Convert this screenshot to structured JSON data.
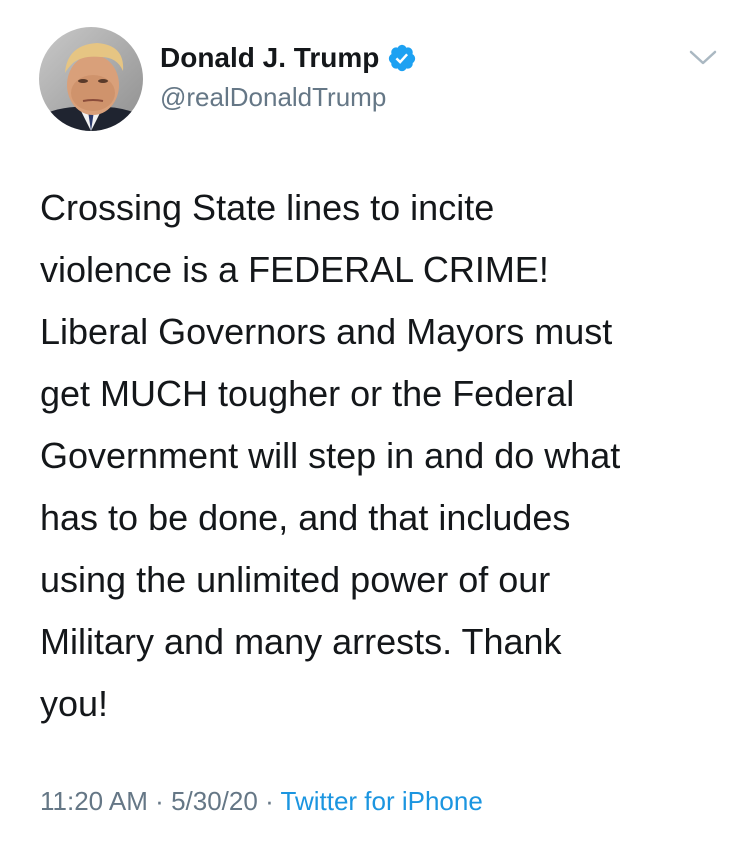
{
  "author": {
    "display_name": "Donald J. Trump",
    "handle": "@realDonaldTrump",
    "verified": true,
    "verified_icon": "verified-badge-icon",
    "avatar": "profile-photo"
  },
  "menu": {
    "icon": "chevron-down-icon"
  },
  "tweet": {
    "lines": [
      "Crossing State lines to incite",
      "violence is a FEDERAL CRIME!",
      "Liberal Governors and Mayors must",
      "get MUCH tougher or the Federal",
      "Government will step in and do what",
      "has to be done, and that includes",
      "using the unlimited power of our",
      "Military and many arrests. Thank",
      "you!"
    ]
  },
  "meta": {
    "time": "11:20 AM",
    "separator": "·",
    "date": "5/30/20",
    "source": "Twitter for iPhone"
  },
  "colors": {
    "text": "#14171a",
    "secondary": "#657786",
    "link": "#1b95e0",
    "verified": "#1da1f2"
  }
}
